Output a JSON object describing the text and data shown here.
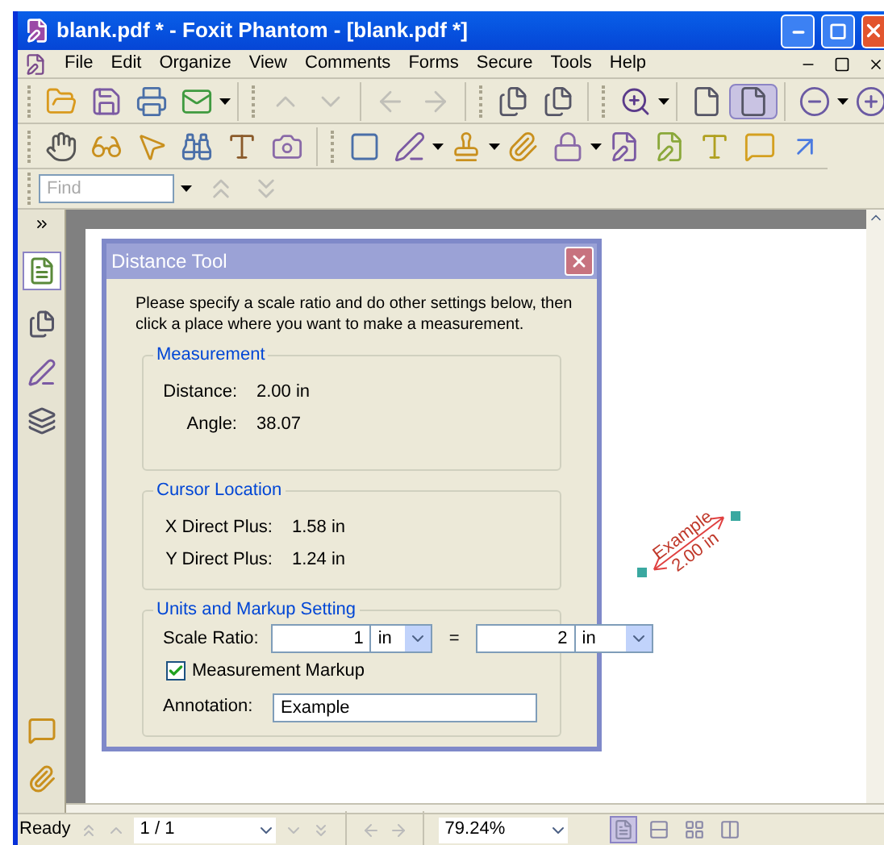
{
  "window": {
    "title": "blank.pdf * - Foxit Phantom - [blank.pdf *]"
  },
  "menu": [
    "File",
    "Edit",
    "Organize",
    "View",
    "Comments",
    "Forms",
    "Secure",
    "Tools",
    "Help"
  ],
  "find": {
    "placeholder": "Find"
  },
  "dialog": {
    "title": "Distance Tool",
    "instructions": "Please specify a scale ratio and do other settings below, then click a place where you want to make a measurement.",
    "measurement": {
      "label": "Measurement",
      "rows": [
        {
          "label": "Distance:",
          "value": "2.00 in"
        },
        {
          "label": "Angle:",
          "value": "38.07"
        }
      ]
    },
    "cursor": {
      "label": "Cursor Location",
      "rows": [
        {
          "label": "X Direct Plus:",
          "value": "1.58 in"
        },
        {
          "label": "Y Direct Plus:",
          "value": "1.24 in"
        }
      ]
    },
    "units": {
      "label": "Units and Markup Setting",
      "scale_label": "Scale Ratio:",
      "value_1": "1",
      "unit_1": "in",
      "equals": "=",
      "value_2": "2",
      "unit_2": "in",
      "markup": {
        "label": "Measurement Markup",
        "checked": true
      },
      "annotation_label": "Annotation:",
      "annotation": "Example"
    }
  },
  "markup": {
    "annotation": "Example",
    "distance": "2.00 in"
  },
  "status_bar": {
    "status": "Ready",
    "page": "1 / 1",
    "zoom": "79.24%",
    "layouts": [
      {
        "selected": true
      },
      {
        "selected": false
      },
      {
        "selected": false
      },
      {
        "selected": false
      }
    ]
  }
}
